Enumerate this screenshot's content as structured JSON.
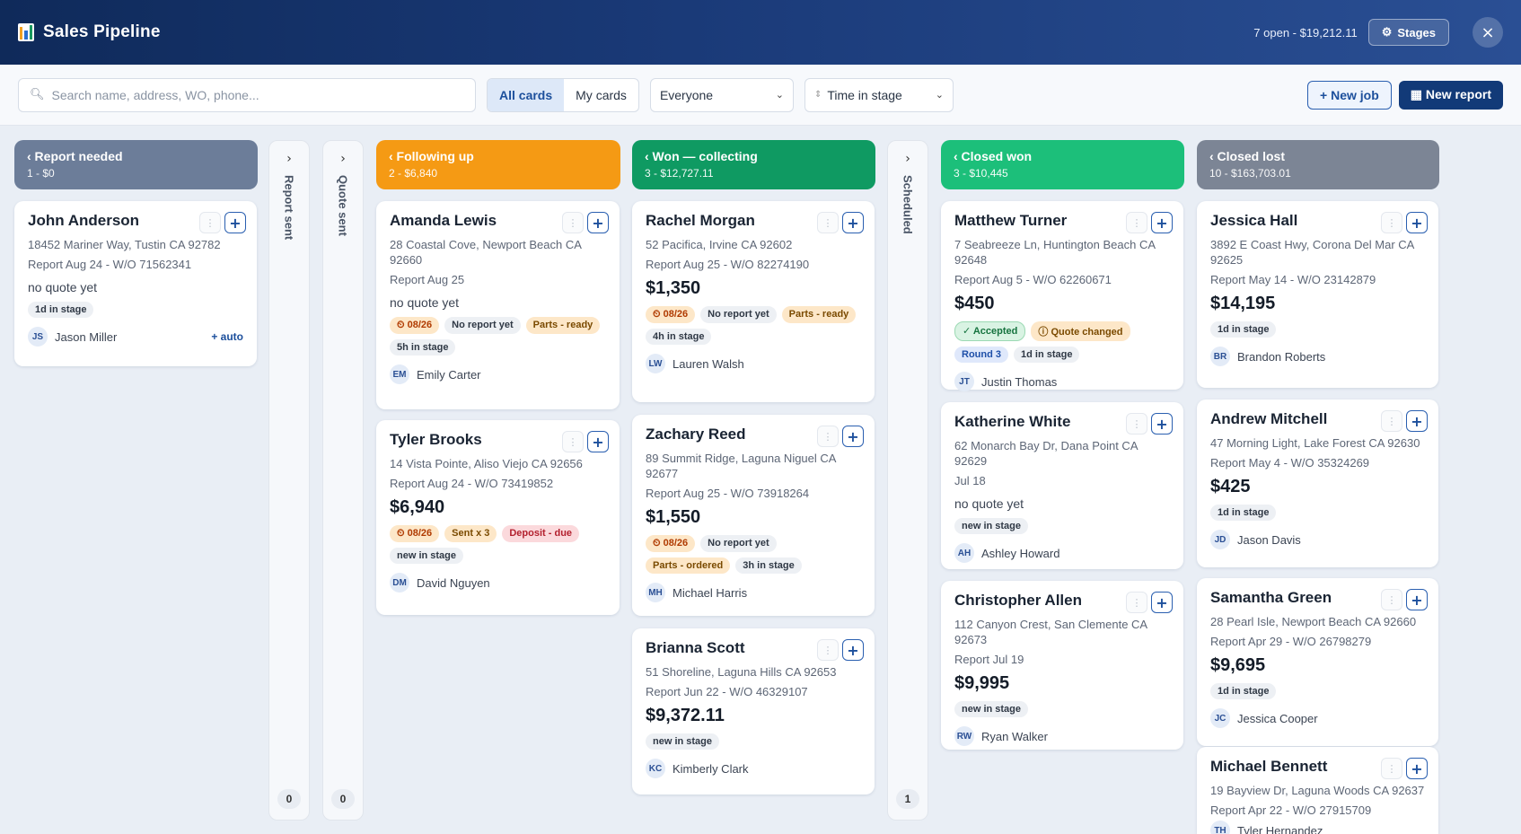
{
  "header": {
    "title": "Sales Pipeline",
    "summary": "7 open - $19,212.11",
    "stages_label": "Stages",
    "close_label": "×"
  },
  "toolbar": {
    "search_placeholder": "Search name, address, WO, phone...",
    "all_cards": "All cards",
    "my_cards": "My cards",
    "assignee_filter": "Everyone",
    "sort_filter": "Time in stage",
    "new_job": "New job",
    "new_report": "New report"
  },
  "columns": [
    {
      "title": "‹ Report needed",
      "summary": "1 - $0",
      "color": "#6c7d99"
    },
    {
      "title": "Report sent",
      "count": "0"
    },
    {
      "title": "Quote sent",
      "count": "0"
    },
    {
      "title": "‹ Following up",
      "summary": "2 - $6,840",
      "color": "#f59a14"
    },
    {
      "title": "‹ Won — collecting",
      "summary": "3 - $12,727.11",
      "color": "#0f9a62"
    },
    {
      "title": "Scheduled",
      "count": "1"
    },
    {
      "title": "‹ Closed won",
      "summary": "3 - $10,445",
      "color": "#1cbf7a"
    },
    {
      "title": "‹ Closed lost",
      "summary": "10 - $163,703.01",
      "color": "#7c8595"
    }
  ],
  "cards": {
    "c1": {
      "name": "John Anderson",
      "addr": "18452 Mariner Way, Tustin CA 92782",
      "meta": "Report Aug 24 - W/O 71562341",
      "note": "no quote yet",
      "tags": [
        "1d in stage"
      ],
      "initials": "JS",
      "assignee": "Jason Miller",
      "auto": "+ auto"
    },
    "c2": {
      "name": "Amanda Lewis",
      "addr": "28 Coastal Cove, Newport Beach CA 92660",
      "meta": "Report Aug 25",
      "note": "no quote yet",
      "date": "08/26",
      "tags": [
        "No report yet",
        "Parts - ready",
        "5h in stage"
      ],
      "initials": "EM",
      "assignee": "Emily Carter"
    },
    "c3": {
      "name": "Tyler Brooks",
      "addr": "14 Vista Pointe, Aliso Viejo CA 92656",
      "meta": "Report Aug 24 - W/O 73419852",
      "price": "$6,940",
      "date": "08/26",
      "tags": [
        "Sent x 3",
        "Deposit - due",
        "new in stage"
      ],
      "initials": "DM",
      "assignee": "David Nguyen"
    },
    "c4": {
      "name": "Rachel Morgan",
      "addr": "52 Pacifica, Irvine CA 92602",
      "meta": "Report Aug 25 - W/O 82274190",
      "price": "$1,350",
      "date": "08/26",
      "tags": [
        "No report yet",
        "Parts - ready",
        "4h in stage"
      ],
      "initials": "LW",
      "assignee": "Lauren Walsh"
    },
    "c5": {
      "name": "Zachary Reed",
      "addr": "89 Summit Ridge, Laguna Niguel CA 92677",
      "meta": "Report Aug 25 - W/O 73918264",
      "price": "$1,550",
      "date": "08/26",
      "tags": [
        "No report yet",
        "Parts - ordered",
        "3h in stage"
      ],
      "initials": "MH",
      "assignee": "Michael Harris"
    },
    "c6": {
      "name": "Brianna Scott",
      "addr": "51 Shoreline, Laguna Hills CA 92653",
      "meta": "Report Jun 22 - W/O 46329107",
      "price": "$9,372.11",
      "tags": [
        "new in stage"
      ],
      "initials": "KC",
      "assignee": "Kimberly Clark"
    },
    "c7": {
      "name": "Matthew Turner",
      "addr": "7 Seabreeze Ln, Huntington Beach CA 92648",
      "meta": "Report Aug 5 - W/O 62260671",
      "price": "$450",
      "tags": [
        "✓ Accepted",
        "ⓘ Quote changed",
        "Round 3",
        "1d in stage"
      ],
      "initials": "JT",
      "assignee": "Justin Thomas"
    },
    "c8": {
      "name": "Katherine White",
      "addr": "62 Monarch Bay Dr, Dana Point CA 92629",
      "meta": "Jul 18",
      "note": "no quote yet",
      "tags": [
        "new in stage"
      ],
      "initials": "AH",
      "assignee": "Ashley Howard"
    },
    "c9": {
      "name": "Christopher Allen",
      "addr": "112 Canyon Crest, San Clemente CA 92673",
      "meta": "Report Jul 19",
      "price": "$9,995",
      "tags": [
        "new in stage"
      ],
      "initials": "RW",
      "assignee": "Ryan Walker"
    },
    "c10": {
      "name": "Jessica Hall",
      "addr": "3892 E Coast Hwy, Corona Del Mar CA 92625",
      "meta": "Report May 14 - W/O 23142879",
      "price": "$14,195",
      "tags": [
        "1d in stage"
      ],
      "initials": "BR",
      "assignee": "Brandon Roberts"
    },
    "c11": {
      "name": "Andrew Mitchell",
      "addr": "47 Morning Light, Lake Forest CA 92630",
      "meta": "Report May 4 - W/O 35324269",
      "price": "$425",
      "tags": [
        "1d in stage"
      ],
      "initials": "JD",
      "assignee": "Jason Davis"
    },
    "c12": {
      "name": "Samantha Green",
      "addr": "28 Pearl Isle, Newport Beach CA 92660",
      "meta": "Report Apr 29 - W/O 26798279",
      "price": "$9,695",
      "tags": [
        "1d in stage"
      ],
      "initials": "JC",
      "assignee": "Jessica Cooper"
    },
    "c13": {
      "name": "Michael Bennett",
      "addr": "19 Bayview Dr, Laguna Woods CA 92637",
      "meta": "Report Apr 22 - W/O 27915709",
      "initials": "TH",
      "assignee": "Tyler Hernandez"
    }
  }
}
